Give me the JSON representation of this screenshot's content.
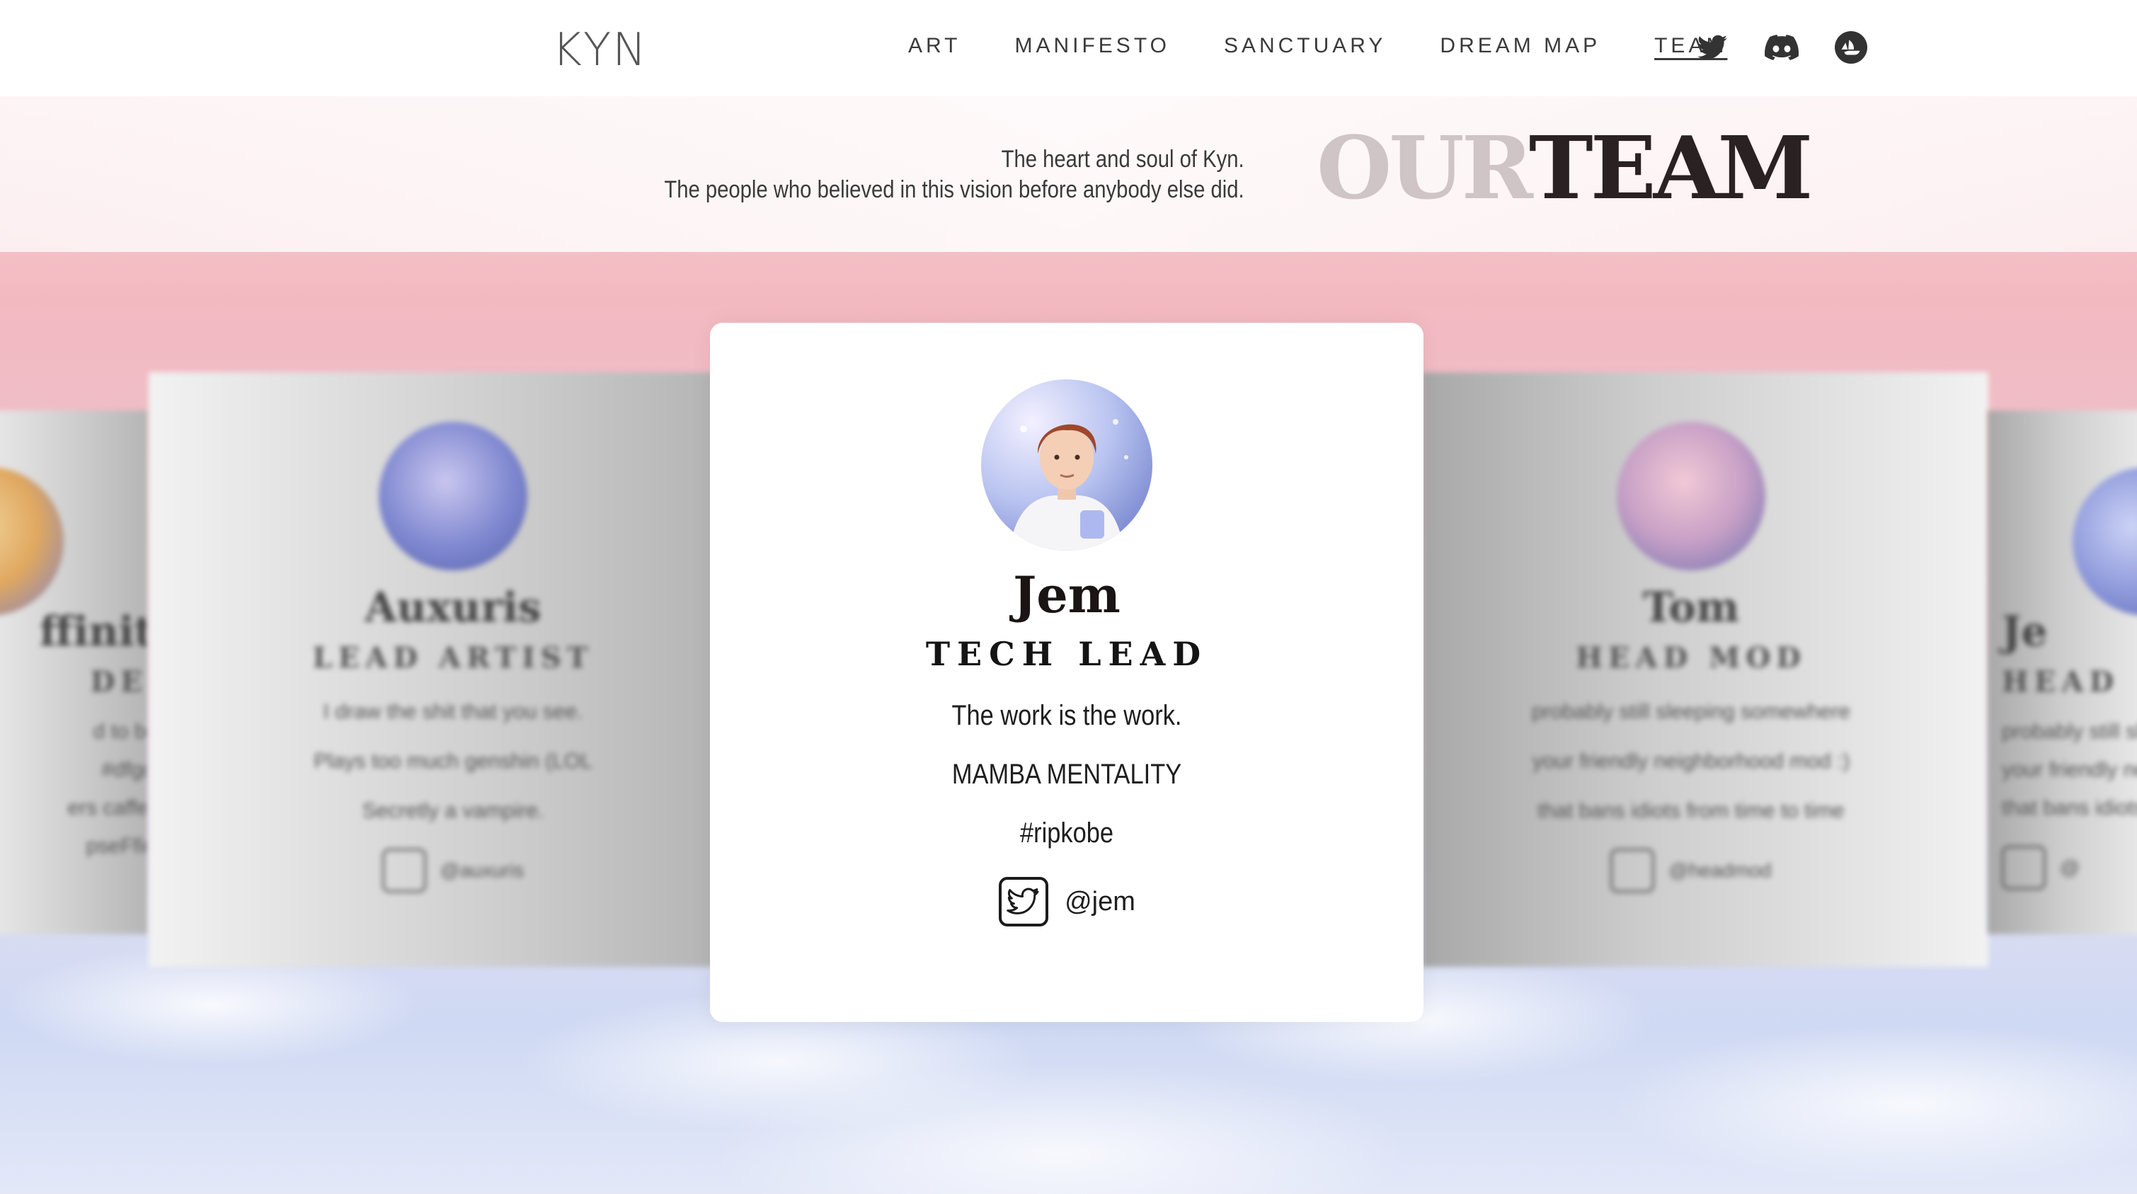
{
  "header": {
    "logo": "KYN",
    "nav": [
      {
        "label": "ART"
      },
      {
        "label": "MANIFESTO"
      },
      {
        "label": "SANCTUARY"
      },
      {
        "label": "DREAM MAP"
      },
      {
        "label": "TEAM",
        "active": true
      }
    ],
    "social": [
      "twitter-icon",
      "discord-icon",
      "opensea-icon"
    ]
  },
  "hero": {
    "tagline_line1": "The heart and soul of Kyn.",
    "tagline_line2": "The people who believed in this vision before anybody else did.",
    "title_part1": "OUR",
    "title_part2": "TEAM"
  },
  "team": {
    "active": {
      "name": "Jem",
      "role": "TECH LEAD",
      "lines": [
        "The work is the work.",
        "MAMBA MENTALITY",
        "#ripkobe"
      ],
      "handle": "@jem"
    },
    "left_far": {
      "name": "ffinity",
      "role": "DER",
      "lines": [
        "d to be :)",
        "#dfgdes",
        "ers caffeine",
        "pseFfinity"
      ]
    },
    "left": {
      "name": "Auxuris",
      "role": "LEAD ARTIST",
      "lines": [
        "I draw the shit that you see.",
        "Plays too much genshin (LOL",
        "Secretly a vampire."
      ],
      "handle": "@auxuris"
    },
    "right": {
      "name": "Tom",
      "role": "HEAD MOD",
      "lines": [
        "probably still sleeping somewhere",
        "your friendly neighborhood mod :)",
        "that bans idiots from time to time"
      ],
      "handle": "@headmod"
    },
    "right_far": {
      "name": "Je",
      "role": "HEAD",
      "lines": [
        "probably still sl",
        "your friendly ne",
        "that bans idiots f"
      ],
      "handle": "@"
    }
  },
  "colors": {
    "accent_dark": "#2a2222",
    "accent_light": "#cfc4c6",
    "card_bg": "#ffffff"
  }
}
